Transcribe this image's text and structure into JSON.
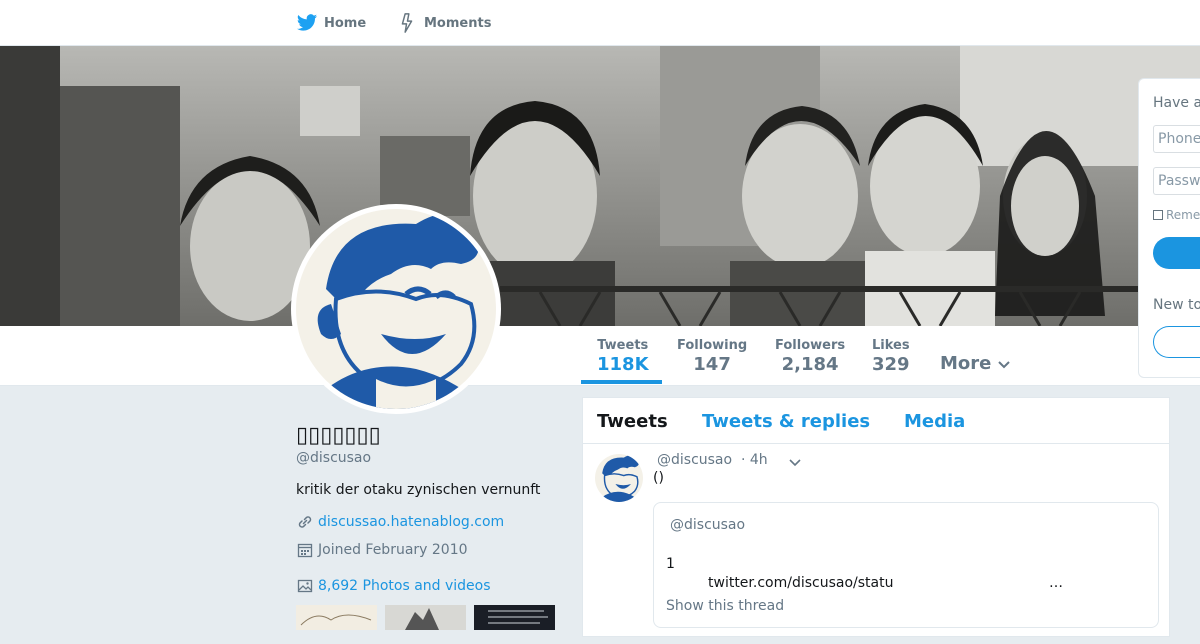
{
  "nav": {
    "home_label": "Home",
    "moments_label": "Moments"
  },
  "profile": {
    "display_name": "▯▯▯▯▯▯▯",
    "handle": "@discusao",
    "bio": "kritik der otaku zynischen vernunft",
    "website": "discussao.hatenablog.com",
    "joined": "Joined February 2010",
    "photos_videos": "8,692 Photos and videos"
  },
  "stats": [
    {
      "label": "Tweets",
      "value": "118K",
      "active": true
    },
    {
      "label": "Following",
      "value": "147"
    },
    {
      "label": "Followers",
      "value": "2,184"
    },
    {
      "label": "Likes",
      "value": "329"
    }
  ],
  "more_label": "More",
  "login": {
    "title": "Have an account?",
    "phone_placeholder": "Phone, email, or username",
    "password_placeholder": "Password",
    "remember": "Remember me",
    "new_to": "New to Twitter?"
  },
  "timeline": {
    "tabs": [
      "Tweets",
      "Tweets & replies",
      "Media"
    ],
    "tweet": {
      "handle": "@discusao",
      "time": "· 4h",
      "text": "()",
      "quote": {
        "handle": "@discusao",
        "number": "1",
        "link": "twitter.com/discusao/statu",
        "ellipsis": "…",
        "show_thread": "Show this thread"
      }
    }
  },
  "colors": {
    "accent": "#1b95e0",
    "muted": "#657786",
    "page_bg": "#e6ecf0"
  }
}
